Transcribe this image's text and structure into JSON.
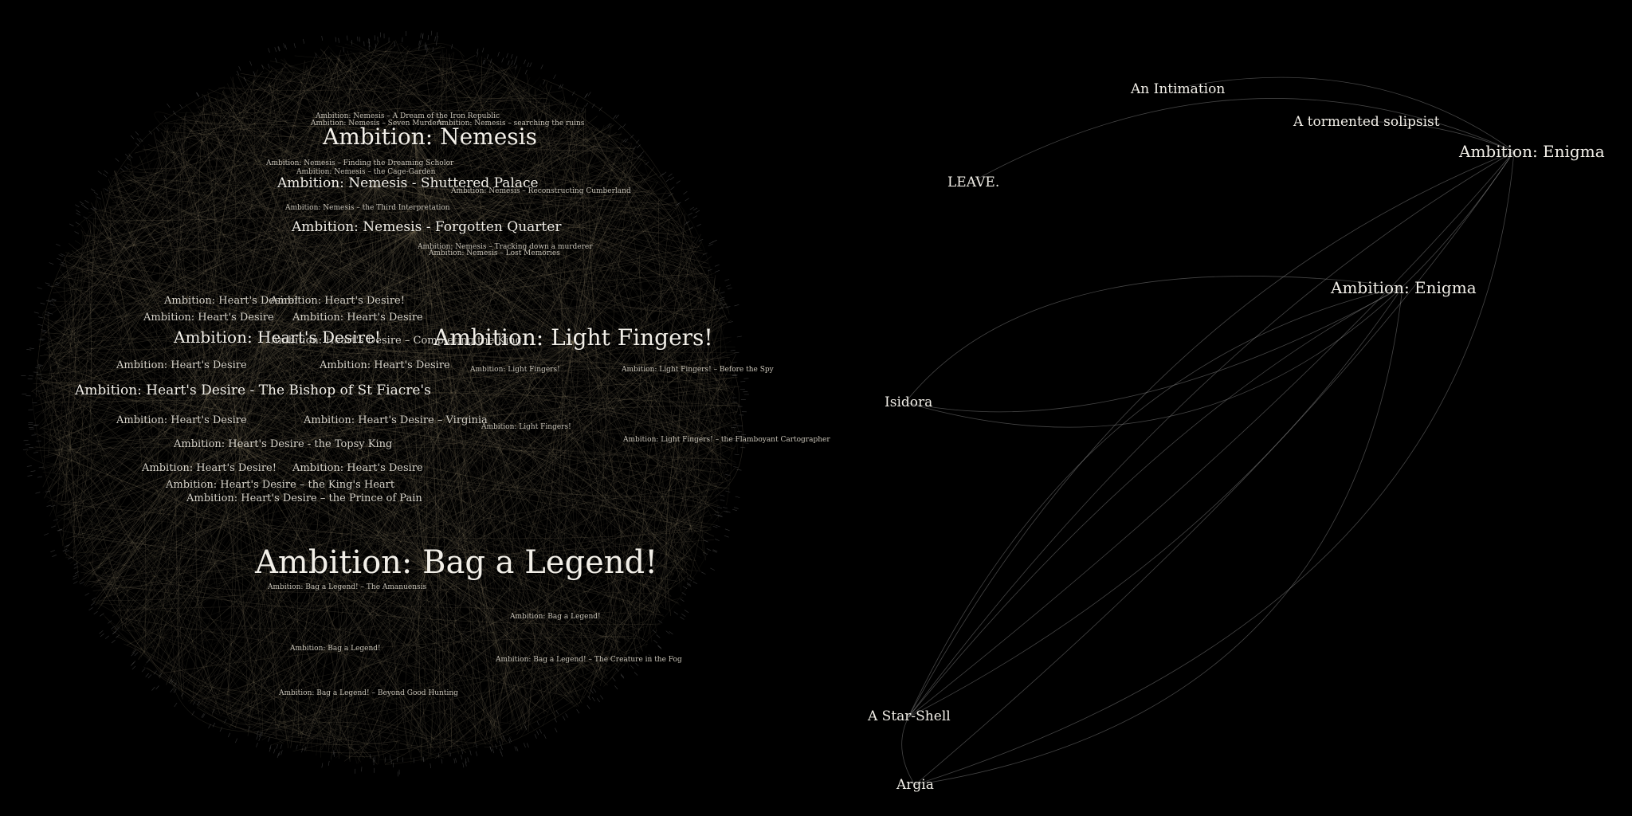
{
  "left_cluster": {
    "hubs": {
      "nemesis": "Ambition: Nemesis",
      "nemesis_shuttered": "Ambition: Nemesis - Shuttered Palace",
      "nemesis_forgotten": "Ambition: Nemesis - Forgotten Quarter",
      "hearts_desire": "Ambition: Heart's Desire!",
      "hearts_bishop": "Ambition: Heart's Desire - The Bishop of St Fiacre's",
      "hearts_topsy": "Ambition: Heart's Desire - the Topsy King",
      "light_fingers": "Ambition: Light Fingers!",
      "bag_legend": "Ambition: Bag a Legend!"
    },
    "minor": {
      "nemesis_a": "Ambition: Nemesis – A Dream of the Iron Republic",
      "nemesis_b": "Ambition: Nemesis – Seven Murders",
      "nemesis_c": "Ambition: Nemesis – searching the ruins",
      "nemesis_d": "Ambition: Nemesis – Finding the Dreaming Scholor",
      "nemesis_e": "Ambition: Nemesis – the Cage-Garden",
      "nemesis_f": "Ambition: Nemesis – Reconstructing Cumberland",
      "nemesis_g": "Ambition: Nemesis – the Third Interpretation",
      "nemesis_h": "Ambition: Nemesis – Tracking down a murderer",
      "nemesis_i": "Ambition: Nemesis – Lost Memories",
      "hd_1": "Ambition: Heart's Desire!",
      "hd_2": "Ambition: Heart's Desire",
      "hd_3": "Ambition: Heart's Desire – Completing the King",
      "hd_4": "Ambition: Heart's Desire – Virginia",
      "hd_5": "Ambition: Heart's Desire – the King's Heart",
      "hd_6": "Ambition: Heart's Desire – the Prince of Pain",
      "lf_1": "Ambition: Light Fingers!",
      "lf_2": "Ambition: Light Fingers! – Before the Spy",
      "lf_3": "Ambition: Light Fingers! – the Flamboyant Cartographer",
      "bl_1": "Ambition: Bag a Legend! – The Amanuensis",
      "bl_2": "Ambition: Bag a Legend! – Beyond Good Hunting",
      "bl_3": "Ambition: Bag a Legend! – The Creature in the Fog",
      "bl_4": "Ambition: Bag a Legend!"
    }
  },
  "right_graph": {
    "intimation": "An Intimation",
    "solipsist": "A tormented solipsist",
    "enigma_1": "Ambition: Enigma",
    "enigma_2": "Ambition: Enigma",
    "leave": "LEAVE.",
    "isidora": "Isidora",
    "star_shell": "A Star-Shell",
    "argia": "Argia"
  },
  "colors": {
    "background": "#000000",
    "label": "#f2efe8",
    "edge_left": "#8a7e66",
    "edge_right": "#9a9a9a"
  }
}
